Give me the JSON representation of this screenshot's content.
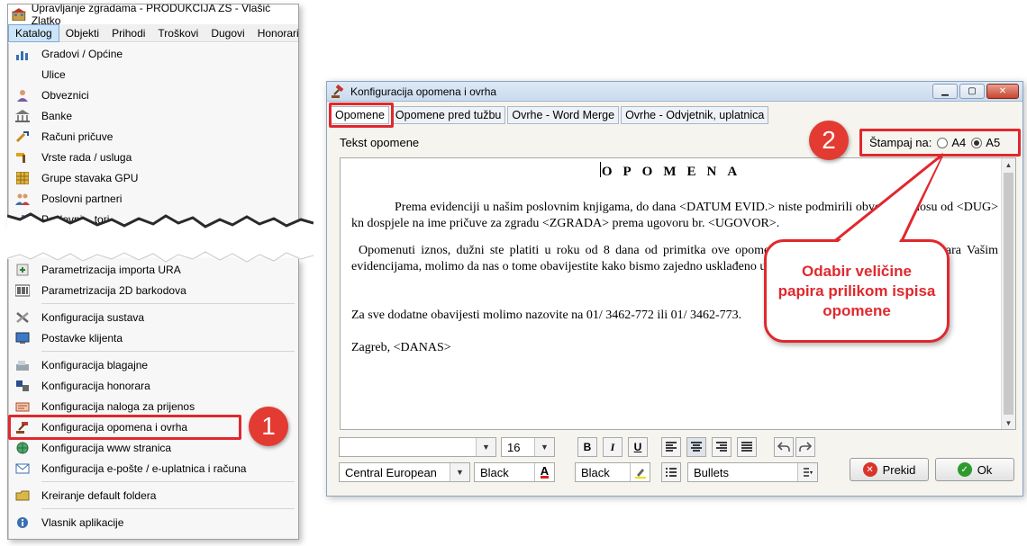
{
  "left_window": {
    "title": "Upravljanje zgradama - PRODUKCIJA ZS - Vlašić Zlatko",
    "menubar": [
      "Katalog",
      "Objekti",
      "Prihodi",
      "Troškovi",
      "Dugovi",
      "Honorari"
    ],
    "menu_top": [
      {
        "label": "Gradovi / Općine",
        "icon": "city-chart-icon"
      },
      {
        "label": "Ulice",
        "icon": ""
      },
      {
        "label": "Obveznici",
        "icon": "person-icon"
      },
      {
        "label": "Banke",
        "icon": "bank-icon"
      },
      {
        "label": "Računi pričuve",
        "icon": "tools-icon"
      },
      {
        "label": "Vrste rada / usluga",
        "icon": "hammer-icon"
      },
      {
        "label": "Grupe stavaka GPU",
        "icon": "grid-icon"
      },
      {
        "label": "Poslovni partneri",
        "icon": "people-icon"
      },
      {
        "label": "Poslovni ...tori",
        "icon": "chart-icon"
      }
    ],
    "menu_bottom": [
      {
        "label": "Parametrizacija importa URA",
        "icon": "import-icon"
      },
      {
        "label": "Parametrizacija 2D barkodova",
        "icon": "barcode-icon"
      },
      {
        "sep": true
      },
      {
        "label": "Konfiguracija sustava",
        "icon": "wrench-icon"
      },
      {
        "label": "Postavke klijenta",
        "icon": "monitor-icon"
      },
      {
        "sep": true
      },
      {
        "label": "Konfiguracija blagajne",
        "icon": "cash-register-icon"
      },
      {
        "label": "Konfiguracija honorara",
        "icon": "honorar-icon"
      },
      {
        "label": "Konfiguracija naloga za prijenos",
        "icon": "transfer-icon"
      },
      {
        "label": "Konfiguracija opomena i ovrha",
        "icon": "gavel-icon"
      },
      {
        "label": "Konfiguracija www stranica",
        "icon": "globe-icon"
      },
      {
        "label": "Konfiguracija e-pošte / e-uplatnica i računa",
        "icon": "mail-icon"
      },
      {
        "sep": true
      },
      {
        "label": "Kreiranje default foldera",
        "icon": "folder-icon"
      },
      {
        "sep": true
      },
      {
        "label": "Vlasnik aplikacije",
        "icon": "info-icon"
      }
    ]
  },
  "dialog": {
    "title": "Konfiguracija opomena i ovrha",
    "tabs": [
      "Opomene",
      "Opomene pred tužbu",
      "Ovrhe - Word Merge",
      "Ovrhe - Odvjetnik, uplatnica"
    ],
    "tekst_label": "Tekst opomene",
    "stampaj_label": "Štampaj na:",
    "paper_options": [
      {
        "label": "A4",
        "selected": false
      },
      {
        "label": "A5",
        "selected": true
      }
    ],
    "document": {
      "title": "OPOMENA",
      "p1": "Prema evidenciji u našim poslovnim knjigama, do dana <DATUM EVID.> niste podmirili obveze u iznosu od <DUG> kn dospjele na ime pričuve za zgradu <ZGRADA> prema ugovoru br. <UGOVOR>.",
      "p2": "Opomenuti iznos, dužni ste platiti u roku od 8 dana od primitka ove opomene. Ukoliko ovo stanje ne odgovara Vašim evidencijama, molimo da nas o tome obavijestite kako bismo zajedno usklađeno uskladili karticu Vašeg prostora.",
      "p3": "Za sve dodatne obavijesti molimo nazovite na 01/ 3462-772 ili 01/ 3462-773.",
      "p4": "Zagreb, <DANAS>"
    },
    "toolbar": {
      "font_name": "",
      "font_size": "16",
      "charset": "Central European",
      "font_color": "Black",
      "highlight_color": "Black",
      "list_style": "Bullets",
      "bold": "B",
      "italic": "I",
      "underline": "U"
    },
    "buttons": {
      "cancel": "Prekid",
      "ok": "Ok"
    }
  },
  "annotations": {
    "badge1": "1",
    "badge2": "2",
    "callout": "Odabir veličine papira prilikom ispisa opomene",
    "accent_color": "#e0282e"
  }
}
